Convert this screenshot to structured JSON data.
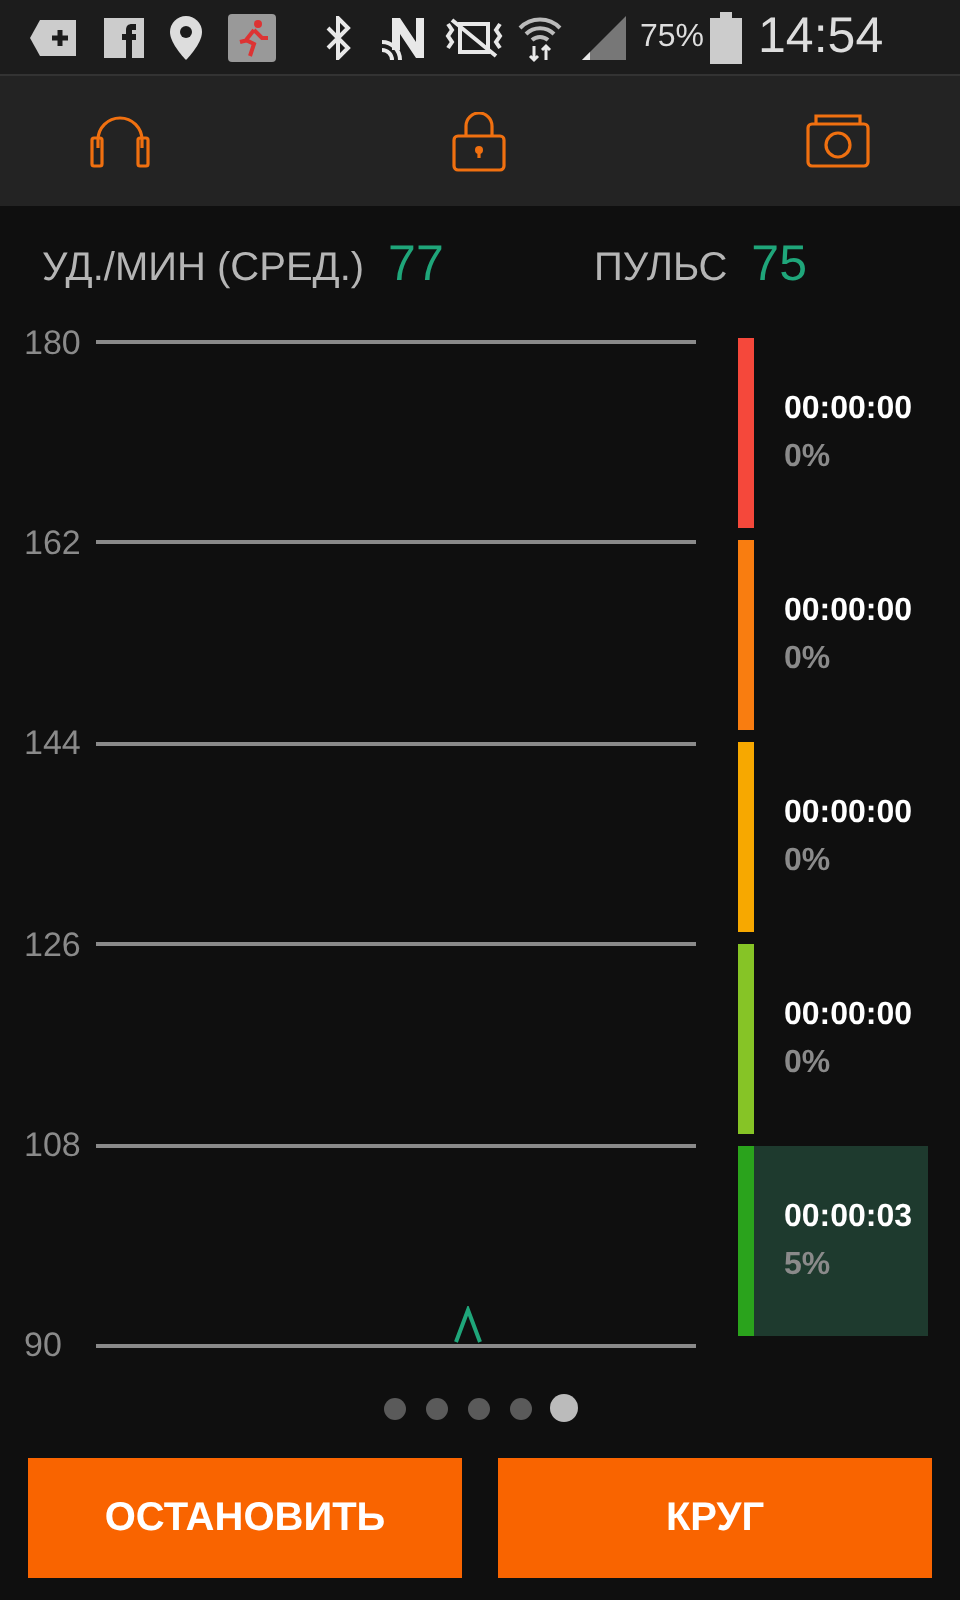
{
  "status_bar": {
    "battery": "75%",
    "time": "14:54"
  },
  "stats": [
    {
      "label": "УД./МИН (СРЕД.)",
      "value": "77"
    },
    {
      "label": "ПУЛЬС",
      "value": "75"
    }
  ],
  "chart": {
    "y_labels": [
      "180",
      "162",
      "144",
      "126",
      "108",
      "90"
    ]
  },
  "zones": [
    {
      "color": "#f5483b",
      "time": "00:00:00",
      "percent": "0%",
      "selected": false
    },
    {
      "color": "#f97d10",
      "time": "00:00:00",
      "percent": "0%",
      "selected": false
    },
    {
      "color": "#f7a800",
      "time": "00:00:00",
      "percent": "0%",
      "selected": false
    },
    {
      "color": "#86c426",
      "time": "00:00:00",
      "percent": "0%",
      "selected": false
    },
    {
      "color": "#2aa31c",
      "time": "00:00:03",
      "percent": "5%",
      "selected": true
    }
  ],
  "pages": [
    {
      "selected": false
    },
    {
      "selected": false
    },
    {
      "selected": false
    },
    {
      "selected": false
    },
    {
      "selected": true
    }
  ],
  "buttons": [
    "ОСТАНОВИТЬ",
    "КРУГ"
  ]
}
